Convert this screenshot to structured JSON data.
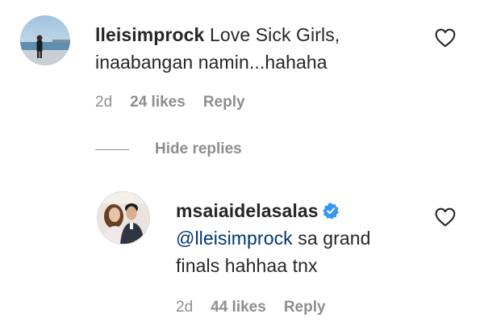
{
  "comment": {
    "username": "lleisimprock",
    "text_line1": "Love Sick Girls,",
    "text_line2": "inaabangan namin...hahaha",
    "time": "2d",
    "likes": "24 likes",
    "reply": "Reply"
  },
  "replies_toggle": {
    "label": "Hide replies"
  },
  "reply": {
    "username": "msaiaidelasalas",
    "verified": true,
    "mention": "@lleisimprock",
    "text_line1": " sa grand",
    "text_line2": "finals hahhaa tnx",
    "time": "2d",
    "likes": "44 likes",
    "reply": "Reply"
  },
  "colors": {
    "text": "#262626",
    "secondary": "#8e8e8e",
    "mention": "#00376b",
    "verified": "#3897f0"
  },
  "icons": {
    "like": "heart-outline-icon",
    "verified": "verified-badge-icon"
  }
}
